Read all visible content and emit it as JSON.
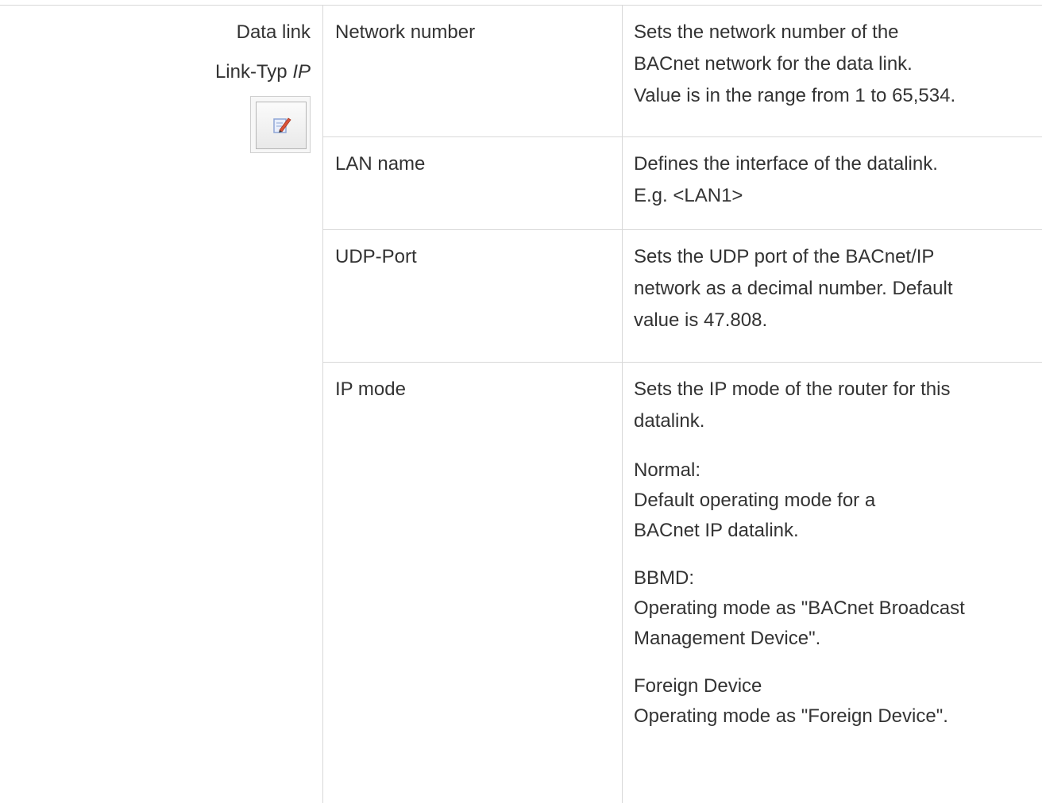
{
  "left": {
    "title": "Data link",
    "link_type_label": "Link-Typ",
    "link_type_value": "IP",
    "edit_icon": "edit-icon"
  },
  "rows": [
    {
      "name": "Network number",
      "desc": [
        "Sets the network number of the",
        "BACnet network for the data link.",
        "Value is in the range from 1 to 65,534."
      ]
    },
    {
      "name": "LAN name",
      "desc": [
        "Defines the interface of the datalink.",
        "E.g. <LAN1>"
      ]
    },
    {
      "name": "UDP-Port",
      "desc": [
        "Sets the UDP port of the BACnet/IP",
        "network as a decimal number. Default",
        "value is 47.808."
      ]
    },
    {
      "name": "IP mode",
      "desc": [
        "Sets the IP mode of the router for this",
        "datalink."
      ],
      "modes": [
        {
          "label": "Normal:",
          "lines": [
            "Default operating mode for a",
            "BACnet IP datalink."
          ]
        },
        {
          "label": "BBMD:",
          "lines": [
            "Operating mode as \"BACnet Broadcast",
            "Management Device\"."
          ]
        },
        {
          "label": "Foreign Device",
          "lines": [
            "Operating mode as \"Foreign Device\"."
          ]
        }
      ]
    }
  ]
}
